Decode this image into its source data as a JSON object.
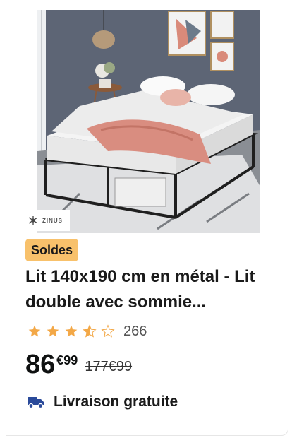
{
  "product": {
    "brand": "ZINUS",
    "badge": "Soldes",
    "title": "Lit 140x190 cm en métal - Lit double avec sommie...",
    "rating": 3.5,
    "rating_max": 5,
    "review_count": "266",
    "price_whole": "86",
    "price_fraction": "€99",
    "old_price": "177€99",
    "shipping": "Livraison gratuite"
  },
  "colors": {
    "badge": "#f8c16b",
    "star": "#f3a847",
    "shipping_icon": "#2a4a9a"
  },
  "icons": {
    "star": "star-icon",
    "truck": "truck-icon",
    "brand": "zinus-logo-icon"
  }
}
